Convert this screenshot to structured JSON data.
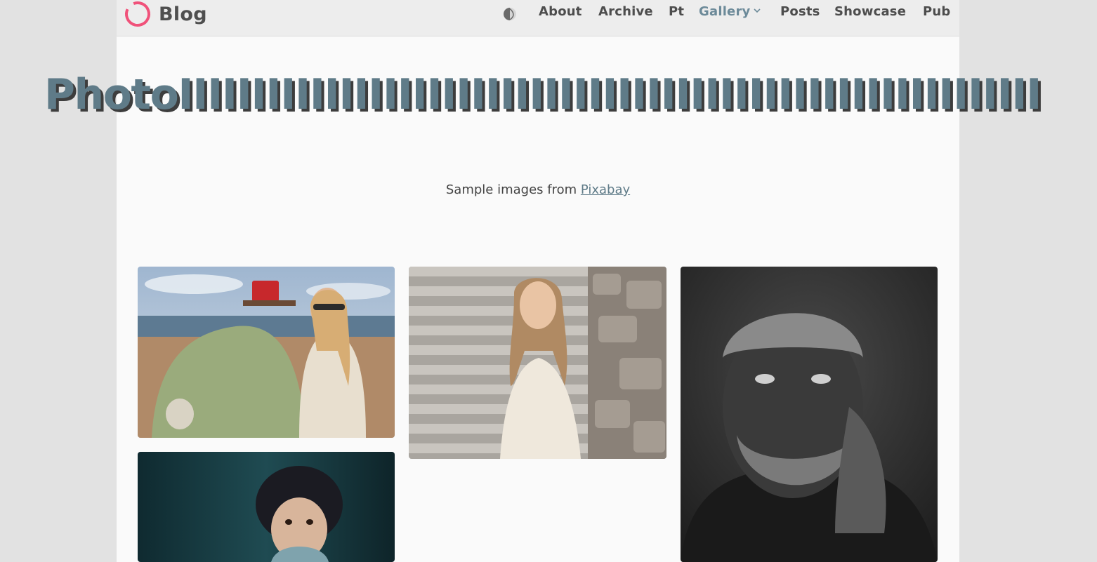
{
  "site": {
    "title": "Blog"
  },
  "nav": {
    "theme_toggle_icon": "contrast-icon",
    "items": [
      {
        "label": "About"
      },
      {
        "label": "Archive"
      },
      {
        "label": "Pt"
      },
      {
        "label": "Gallery",
        "active": true,
        "has_dropdown": true
      },
      {
        "label": "Posts"
      },
      {
        "label": "Showcase"
      },
      {
        "label": "Pub"
      }
    ]
  },
  "hero": {
    "title": "PhotoIIIIIIIIIIIIIIIIIIIIIIIIIIIIIIIIIIIIIIIIIIIIIIIIIIIIIIIIIIIIIIIIIIIIIIIIIIIIIIIIIIIIIIIIIIIIIIIIIIIIIIIIIIIIIIIIIIII"
  },
  "intro": {
    "text": "Sample images from",
    "link_label": "Pixabay"
  },
  "colors": {
    "accent": "#5f7b88",
    "logo": "#f0527a",
    "page_bg": "#fafafa",
    "outer_bg": "#e2e2e2",
    "nav_bg": "#ededed"
  },
  "gallery": {
    "images": [
      {
        "subject": "woman-with-vintage-car"
      },
      {
        "subject": "woman-on-stone-steps"
      },
      {
        "subject": "elderly-man-portrait"
      },
      {
        "subject": "curly-haired-child"
      }
    ]
  }
}
